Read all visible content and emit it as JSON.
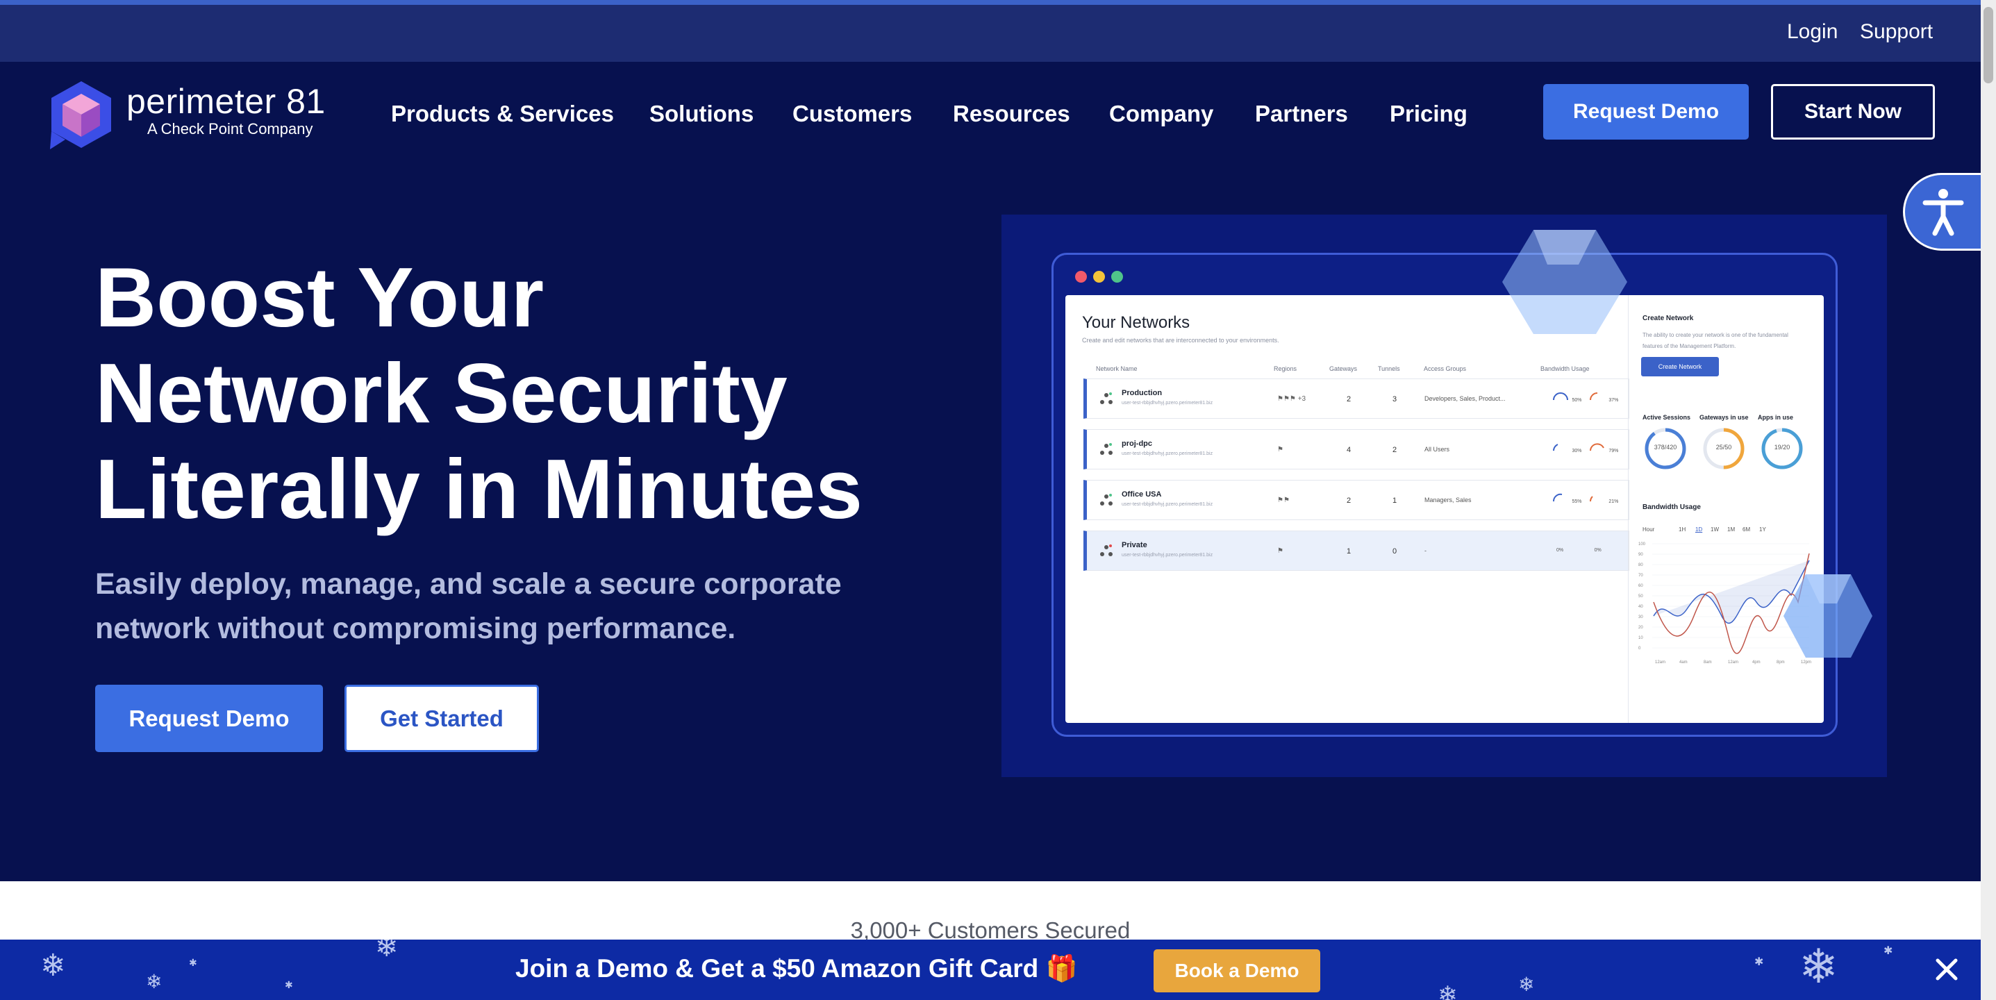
{
  "utility_nav": {
    "login": "Login",
    "support": "Support"
  },
  "brand": {
    "name": "perimeter 81",
    "tagline": "A Check Point Company"
  },
  "nav": {
    "items": [
      "Products & Services",
      "Solutions",
      "Customers",
      "Resources",
      "Company",
      "Partners",
      "Pricing"
    ],
    "request_demo": "Request Demo",
    "start_now": "Start Now"
  },
  "hero": {
    "title_lines": [
      "Boost Your",
      "Network Security",
      "Literally in Minutes"
    ],
    "subtitle_lines": [
      "Easily deploy, manage, and scale a secure corporate",
      "network without compromising performance."
    ],
    "cta_primary": "Request Demo",
    "cta_secondary": "Get Started"
  },
  "mockup": {
    "title": "Your Networks",
    "description": "Create and edit networks that are interconnected to your environments.",
    "columns": [
      "Network Name",
      "Regions",
      "Gateways",
      "Tunnels",
      "Access Groups",
      "Bandwidth Usage"
    ],
    "rows": [
      {
        "name": "Production",
        "host": "user-test-rbbjdhvhyj.pzero.perimeter81.biz",
        "regions": "+3",
        "gateways": "2",
        "tunnels": "3",
        "groups": "Developers, Sales, Product...",
        "bw1": "50%",
        "bw2": "37%"
      },
      {
        "name": "proj-dpc",
        "host": "user-test-rbbjdhvhyj.pzero.perimeter81.biz",
        "regions": "",
        "gateways": "4",
        "tunnels": "2",
        "groups": "All Users",
        "bw1": "30%",
        "bw2": "79%"
      },
      {
        "name": "Office USA",
        "host": "user-test-rbbjdhvhyj.pzero.perimeter81.biz",
        "regions": "",
        "gateways": "2",
        "tunnels": "1",
        "groups": "Managers, Sales",
        "bw1": "55%",
        "bw2": "21%"
      },
      {
        "name": "Private",
        "host": "user-test-rbbjdhvhyj.pzero.perimeter81.biz",
        "regions": "",
        "gateways": "1",
        "tunnels": "0",
        "groups": "-",
        "bw1": "0%",
        "bw2": "0%"
      }
    ],
    "side": {
      "create_title": "Create Network",
      "create_desc": "The ability to create your network is one of the fundamental features of the Management Platform.",
      "create_button": "Create Network",
      "stats": [
        {
          "label": "Active Sessions",
          "value": "378/420",
          "fraction": 0.9,
          "color": "#4a7fd6"
        },
        {
          "label": "Gateways in use",
          "value": "25/50",
          "fraction": 0.5,
          "color": "#f0a63c"
        },
        {
          "label": "Apps in use",
          "value": "19/20",
          "fraction": 0.95,
          "color": "#4a9fd6"
        }
      ],
      "bandwidth_title": "Bandwidth Usage",
      "timeframes": [
        "Hour",
        "1H",
        "1D",
        "1W",
        "1M",
        "6M",
        "1Y"
      ],
      "y_ticks": [
        "100",
        "90",
        "80",
        "70",
        "60",
        "50",
        "40",
        "30",
        "20",
        "10",
        "0"
      ],
      "x_ticks": [
        "12am",
        "4am",
        "8am",
        "12am",
        "4pm",
        "8pm",
        "12pm"
      ]
    }
  },
  "customers": {
    "text": "3,000+ Customers Secured"
  },
  "promo": {
    "text": "Join a Demo & Get a $50 Amazon Gift Card",
    "gift_icon": "🎁",
    "button": "Book a Demo"
  },
  "colors": {
    "hero_bg": "#07114f",
    "accent": "#3b6ee2",
    "promo_bg": "#0d2aa4",
    "promo_button": "#e8a63d"
  }
}
